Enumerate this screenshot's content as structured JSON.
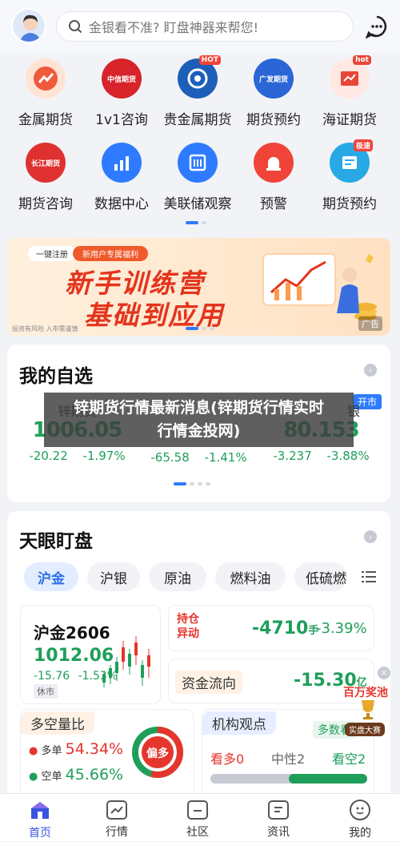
{
  "search": {
    "placeholder": "金银看不准? 盯盘神器来帮您!"
  },
  "grid": [
    {
      "label": "金属期货",
      "icon": "metal-futures-icon",
      "color": "#f05a3c",
      "badge": ""
    },
    {
      "label": "1v1咨询",
      "icon": "citic-futures-icon",
      "color": "#d8232a",
      "badge": "中信期货"
    },
    {
      "label": "贵金属期货",
      "icon": "guoyuan-futures-icon",
      "color": "#1c5eb8",
      "badge": "HOT"
    },
    {
      "label": "期货预约",
      "icon": "guangfa-futures-icon",
      "color": "#2a66d6",
      "badge": "广发期货"
    },
    {
      "label": "海证期货",
      "icon": "training-camp-icon",
      "color": "#e8463a",
      "badge": "hot"
    },
    {
      "label": "期货咨询",
      "icon": "changjiang-futures-icon",
      "color": "#e03131",
      "badge": "长江期货"
    },
    {
      "label": "数据中心",
      "icon": "data-center-icon",
      "color": "#2f7bff",
      "badge": ""
    },
    {
      "label": "美联储观察",
      "icon": "fed-watch-icon",
      "color": "#2f7bff",
      "badge": ""
    },
    {
      "label": "预警",
      "icon": "alarm-icon",
      "color": "#f04438",
      "badge": ""
    },
    {
      "label": "期货预约",
      "icon": "futures-booking-icon",
      "color": "#28a9e6",
      "badge": "极速"
    }
  ],
  "banner": {
    "tag1": "一键注册",
    "tag2": "新用户专属福利",
    "line1": "新手训练营",
    "line2": "基础到应用",
    "risk": "投资有风险 入市需谨慎",
    "ad": "广告"
  },
  "watchlist": {
    "title": "我的自选",
    "open_badge": "开市",
    "quotes": [
      {
        "name": "锌期货",
        "price": "1006.05",
        "change": "-20.22",
        "pct": "-1.97%"
      },
      {
        "name": "",
        "price": "",
        "change": "-65.58",
        "pct": "-1.41%"
      },
      {
        "name": "银",
        "price": "80.153",
        "change": "-3.237",
        "pct": "-3.88%"
      }
    ]
  },
  "overlay": {
    "line1": "锌期货行情最新消息(锌期货行情实时",
    "line2": "行情金投网)"
  },
  "tianyan": {
    "title": "天眼盯盘",
    "tabs": [
      "沪金",
      "沪银",
      "原油",
      "燃料油",
      "低硫燃"
    ],
    "main": {
      "name": "沪金2606",
      "price": "1012.06",
      "change": "-15.76",
      "pct": "-1.53%",
      "status": "休市"
    },
    "holding": {
      "label1": "持仓",
      "label2": "异动",
      "value": "-4710",
      "unit": "手",
      "pct": "-3.39%"
    },
    "capital": {
      "label": "资金流向",
      "value": "-15.30",
      "unit": "亿"
    },
    "longshort": {
      "title": "多空量比",
      "long_label": "多单",
      "long_value": "54.34%",
      "short_label": "空单",
      "short_value": "45.66%",
      "donut": "偏多",
      "long_ratio": 0.5434
    },
    "inst": {
      "title": "机构观点",
      "bull": "看多0",
      "neutral": "中性2",
      "bear": "看空2",
      "tag": "多数看"
    },
    "prize": {
      "line1": "百万奖池",
      "line2": "实盘大赛"
    }
  },
  "tabbar": [
    {
      "label": "首页",
      "icon": "home-icon",
      "active": true
    },
    {
      "label": "行情",
      "icon": "market-chart-icon",
      "active": false
    },
    {
      "label": "社区",
      "icon": "community-icon",
      "active": false
    },
    {
      "label": "资讯",
      "icon": "news-icon",
      "active": false
    },
    {
      "label": "我的",
      "icon": "profile-icon",
      "active": false
    }
  ],
  "colors": {
    "accent": "#2f7bff",
    "down": "#1f9e5a",
    "up": "#e5352c"
  }
}
